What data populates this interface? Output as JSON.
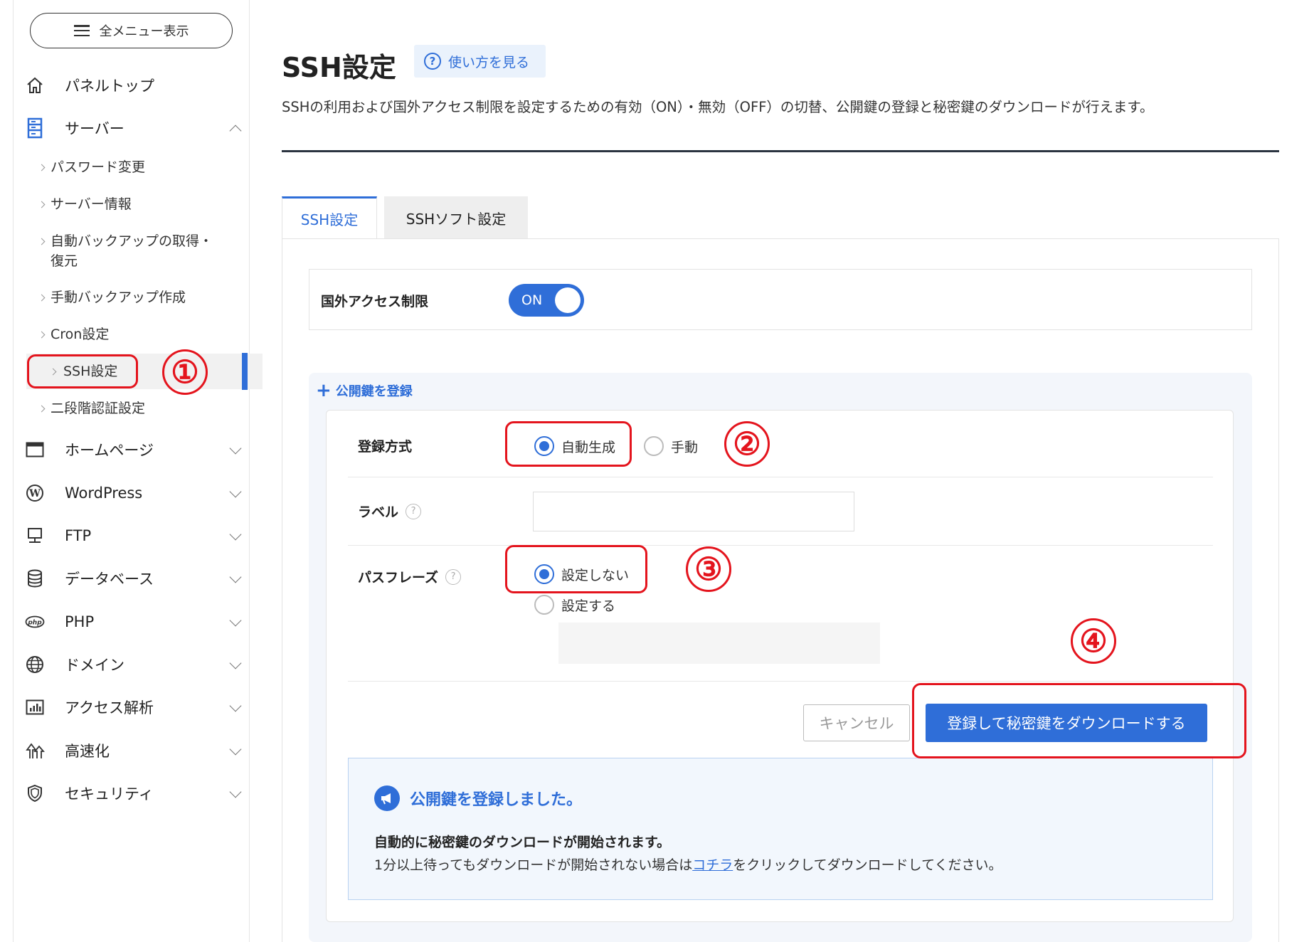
{
  "sidebar": {
    "menu_button": "全メニュー表示",
    "items": [
      {
        "label": "パネルトップ",
        "icon": "home-icon"
      },
      {
        "label": "サーバー",
        "icon": "server-icon"
      },
      {
        "label": "ホームページ",
        "icon": "browser-window-icon"
      },
      {
        "label": "WordPress",
        "icon": "wordpress-icon"
      },
      {
        "label": "FTP",
        "icon": "monitor-icon"
      },
      {
        "label": "データベース",
        "icon": "database-icon"
      },
      {
        "label": "PHP",
        "icon": "php-icon"
      },
      {
        "label": "ドメイン",
        "icon": "globe-icon"
      },
      {
        "label": "アクセス解析",
        "icon": "bar-chart-icon"
      },
      {
        "label": "高速化",
        "icon": "speed-icon"
      },
      {
        "label": "セキュリティ",
        "icon": "shield-icon"
      }
    ],
    "server_sub": [
      "パスワード変更",
      "サーバー情報",
      "自動バックアップの取得・\n復元",
      "手動バックアップ作成",
      "Cron設定",
      "SSH設定",
      "二段階認証設定"
    ],
    "php_icon_text": "php"
  },
  "page": {
    "title": "SSH設定",
    "help_label": "使い方を見る",
    "description": "SSHの利用および国外アクセス制限を設定するための有効（ON）・無効（OFF）の切替、公開鍵の登録と秘密鍵のダウンロードが行えます。"
  },
  "tabs": [
    "SSH設定",
    "SSHソフト設定"
  ],
  "access": {
    "label": "国外アクセス制限",
    "toggle": "ON"
  },
  "register": {
    "toggle_label": "公開鍵を登録",
    "method_label": "登録方式",
    "method_options": [
      "自動生成",
      "手動"
    ],
    "label_label": "ラベル",
    "label_value": "",
    "passphrase_label": "パスフレーズ",
    "passphrase_options": [
      "設定しない",
      "設定する"
    ],
    "passphrase_value": "",
    "cancel": "キャンセル",
    "submit": "登録して秘密鍵をダウンロードする"
  },
  "notice": {
    "title": "公開鍵を登録しました。",
    "strong": "自動的に秘密鍵のダウンロードが開始されます。",
    "text_before": "1分以上待ってもダウンロードが開始されない場合は",
    "link": "コチラ",
    "text_after": "をクリックしてダウンロードしてください。"
  },
  "annotations": [
    "①",
    "②",
    "③",
    "④"
  ],
  "colors": {
    "accent": "#2f6ed8",
    "annotation": "#e4141d",
    "notice_bg": "#f2f7fd"
  }
}
